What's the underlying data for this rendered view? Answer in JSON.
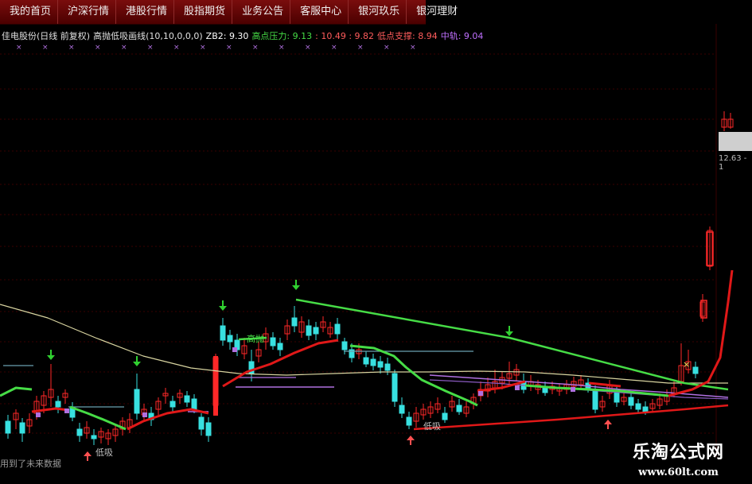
{
  "menu": [
    "我的首页",
    "沪深行情",
    "港股行情",
    "股指期货",
    "业务公告",
    "客服中心",
    "银河玖乐",
    "银河理财"
  ],
  "header": {
    "title": "佳电股份(日线 前复权)",
    "indicator": "高抛低吸画线(10,10,0,0,0)",
    "zb2": "ZB2: 9.30",
    "resist_label": "高点压力: 9.13",
    "resist_vals": ": 10.49 : 9.82",
    "support_label": "低点支撑: 8.94",
    "mid_label": "中轨: 9.04"
  },
  "labels": {
    "high": "高抛",
    "low1": "低吸",
    "low2": "低吸",
    "price": "12.63 - 1",
    "bottom_note": "用到了未来数据"
  },
  "watermark": {
    "title": "乐淘公式网",
    "url": "www.60lt.com"
  },
  "colors": {
    "up": "#ff2828",
    "down": "#38e0e0",
    "green_line": "#46dc46",
    "red_line": "#e01818",
    "ma_line": "#d8d4a0",
    "purple_line": "#b070e0",
    "signal_green": "#30d030",
    "signal_red": "#ff5050"
  },
  "chart_data": {
    "type": "candlestick",
    "series": [
      {
        "name": "高点压力"
      },
      {
        "name": "低点支撑"
      },
      {
        "name": "中轨"
      }
    ]
  }
}
